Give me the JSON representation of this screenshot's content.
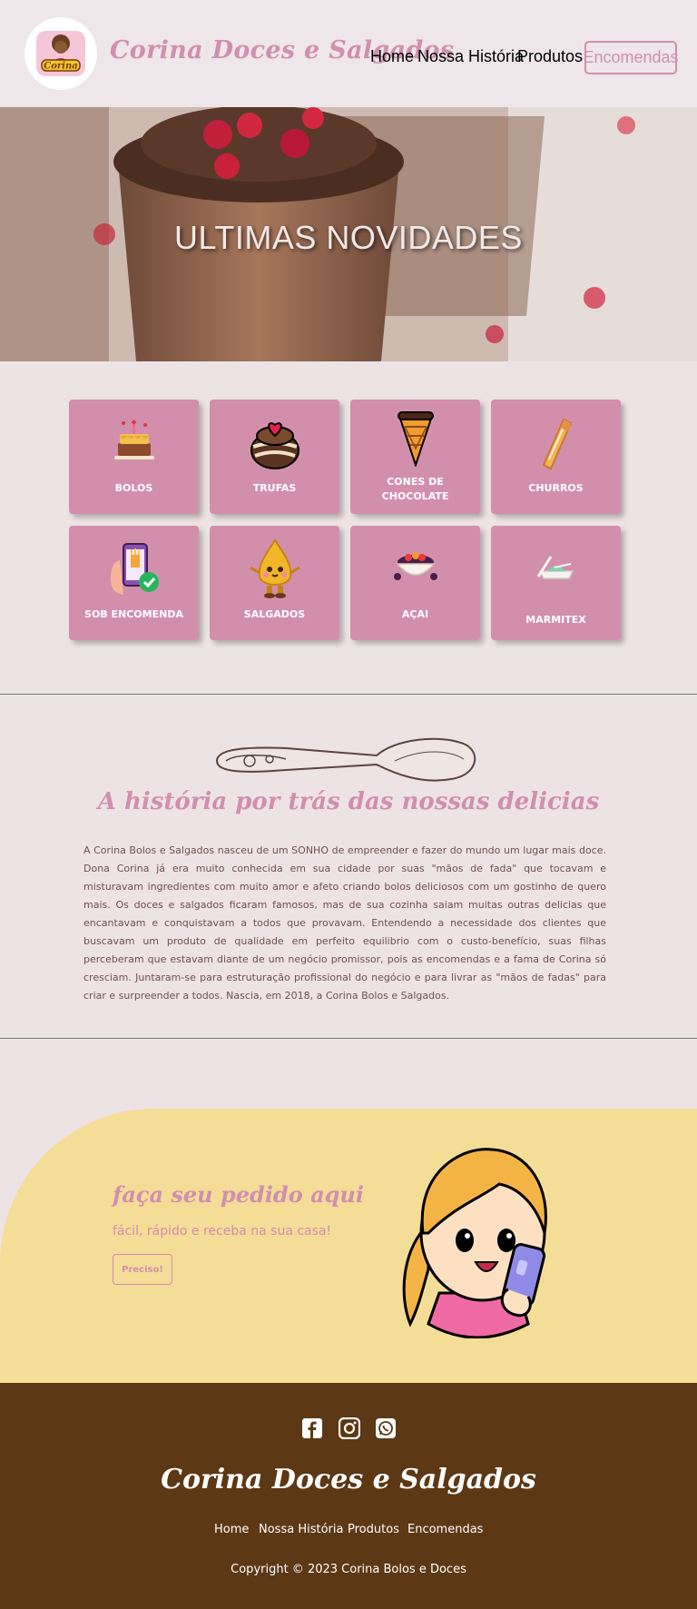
{
  "header": {
    "brand": "Corina Doces e Salgados",
    "logo_text": "Corina",
    "nav": [
      "Home",
      "Nossa História",
      "Produtos"
    ],
    "cta": "Encomendas"
  },
  "hero": {
    "title": "ULTIMAS NOVIDADES"
  },
  "products": [
    {
      "label": "BOLOS",
      "icon": "cake-icon"
    },
    {
      "label": "TRUFAS",
      "icon": "truffle-icon"
    },
    {
      "label": "CONES DE CHOCOLATE",
      "icon": "cone-icon"
    },
    {
      "label": "CHURROS",
      "icon": "churros-icon"
    },
    {
      "label": "SOB ENCOMENDA",
      "icon": "phone-order-icon"
    },
    {
      "label": "SALGADOS",
      "icon": "coxinha-icon"
    },
    {
      "label": "AÇAI",
      "icon": "acai-bowl-icon"
    },
    {
      "label": "MARMITEX",
      "icon": "lunchbox-icon"
    }
  ],
  "story": {
    "title": "A história por trás das nossas delicias",
    "text": "A Corina Bolos e Salgados nasceu de um SONHO de empreender e fazer do mundo um lugar mais doce. Dona Corina já era muito conhecida em sua cidade por suas \"mãos de fada\" que tocavam e misturavam ingredientes com muito amor e afeto criando bolos deliciosos com um gostinho de quero mais. Os doces e salgados ficaram famosos, mas de sua cozinha saiam muitas outras delicias que encantavam e conquistavam a todos que provavam. Entendendo a necessidade dos clientes que buscavam um produto de qualidade em perfeito equilibrio com o custo-benefício, suas filhas perceberam que estavam diante de um negócio promissor, pois as encomendas e a fama de Corina só cresciam. Juntaram-se para estruturação profissional do negócio e para livrar as \"mãos de fadas\" para criar e surpreender a todos. Nascia, em 2018, a Corina Bolos e Salgados."
  },
  "cta": {
    "title": "faça seu pedido aqui",
    "subtitle": "fácil, rápido e receba na sua casa!",
    "button": "Preciso!"
  },
  "footer": {
    "brand": "Corina Doces e Salgados",
    "links": [
      "Home",
      "Nossa História",
      "Produtos",
      "Encomendas"
    ],
    "copyright": "Copyright © 2023 Corina Bolos e Doces",
    "social": [
      "facebook-icon",
      "instagram-icon",
      "whatsapp-icon"
    ]
  },
  "colors": {
    "pink": "#d18fae",
    "card": "#d28fac",
    "yellow": "#f4dd97",
    "footer": "#5c3815",
    "background": "#ede3e5"
  }
}
